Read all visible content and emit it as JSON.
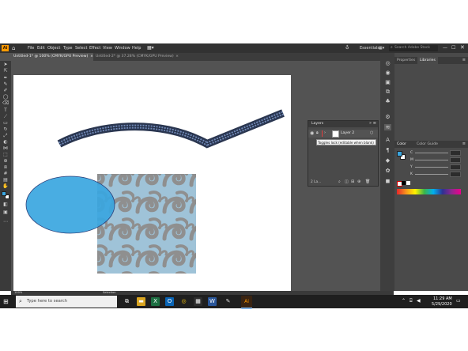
{
  "app": {
    "logo": "Ai",
    "menu": [
      "File",
      "Edit",
      "Object",
      "Type",
      "Select",
      "Effect",
      "View",
      "Window",
      "Help"
    ],
    "workspace": "Essentials",
    "search_placeholder": "Search Adobe Stock"
  },
  "tabs": [
    {
      "label": "Untitled-1* @ 100% (CMYK/GPU Preview)",
      "active": true
    },
    {
      "label": "Untitled-2* @ 37.28% (CMYK/GPU Preview)",
      "active": false
    }
  ],
  "toolbar_icons": [
    "selection-tool",
    "direct-selection-tool",
    "pen-tool",
    "curvature-tool",
    "paintbrush-tool",
    "shaper-tool",
    "eraser-tool",
    "type-tool",
    "line-tool",
    "rectangle-tool",
    "rotate-tool",
    "scale-tool",
    "warp-tool",
    "width-tool",
    "free-transform-tool",
    "shape-builder-tool",
    "perspective-tool",
    "mesh-tool",
    "gradient-tool",
    "eyedropper-tool",
    "blend-tool",
    "symbol-sprayer-tool",
    "graph-tool",
    "artboard-tool",
    "slice-tool",
    "hand-tool",
    "zoom-tool"
  ],
  "layers_panel": {
    "title": "Layers",
    "layer_name": "Layer 2",
    "tooltip": "Toggles lock (editable when blank)",
    "footer_count": "2 La..."
  },
  "right_panel": {
    "tabs": [
      "Properties",
      "Libraries"
    ],
    "color_tabs": [
      "Color",
      "Color Guide"
    ],
    "channels": [
      "C",
      "M",
      "Y",
      "K"
    ]
  },
  "status": {
    "zoom": "100%",
    "tool": "Selection"
  },
  "taskbar": {
    "search_placeholder": "Type here to search",
    "time": "11:29 AM",
    "date": "5/29/2020"
  },
  "colors": {
    "ellipse_fill": "#3aa6e0",
    "ellipse_stroke": "#2a3f7a",
    "pattern_bg": "#9fc3d8",
    "pattern_swirl": "#8d8d8d",
    "brush_stroke": "#3a4a6a",
    "app_bg": "#535353"
  }
}
